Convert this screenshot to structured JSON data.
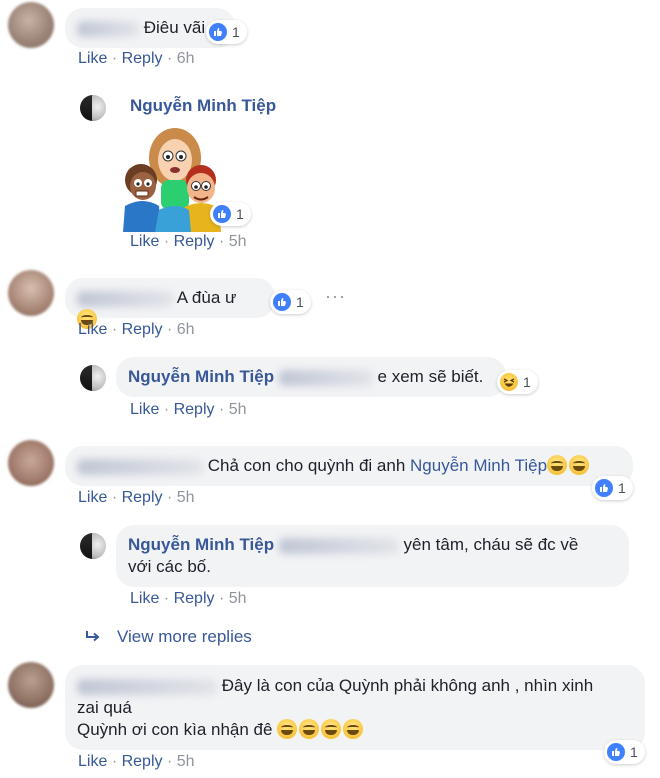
{
  "actions": {
    "like": "Like",
    "reply": "Reply",
    "sep": "·"
  },
  "comments": [
    {
      "text": "Điêu vãi",
      "likes": "1",
      "time": "6h"
    },
    {
      "author": "Nguyễn Minh Tiệp",
      "likes": "1",
      "time": "5h",
      "sticker": "three-kids-sticker"
    },
    {
      "text": "A đùa ư",
      "likes": "1",
      "time": "6h"
    },
    {
      "author": "Nguyễn Minh Tiệp",
      "text": "e xem sẽ biết.",
      "likes": "1",
      "time": "5h"
    },
    {
      "text": "Chả con cho quỳnh đi anh",
      "mention": "Nguyễn Minh Tiệp",
      "likes": "1",
      "time": "5h"
    },
    {
      "author": "Nguyễn Minh Tiệp",
      "text_line1": "yên tâm, cháu sẽ đc về",
      "text_line2": "với các bố.",
      "time": "5h"
    },
    {
      "text_line1": "Đây là con của Quỳnh phải không anh , nhìn xinh",
      "text_line2": "zai quá",
      "text_line3": "Quỳnh ơi con kìa nhận đê",
      "likes": "1",
      "time": "5h"
    }
  ],
  "more_dots": "···",
  "view_more": "View more replies",
  "colors": {
    "link": "#385898",
    "meta": "#90949c",
    "bubble": "#f2f3f5",
    "like_blue": "#4080ff"
  },
  "icons": [
    "like-icon",
    "haha-icon",
    "grin-emoji",
    "reply-arrow-icon",
    "more-options-icon"
  ]
}
